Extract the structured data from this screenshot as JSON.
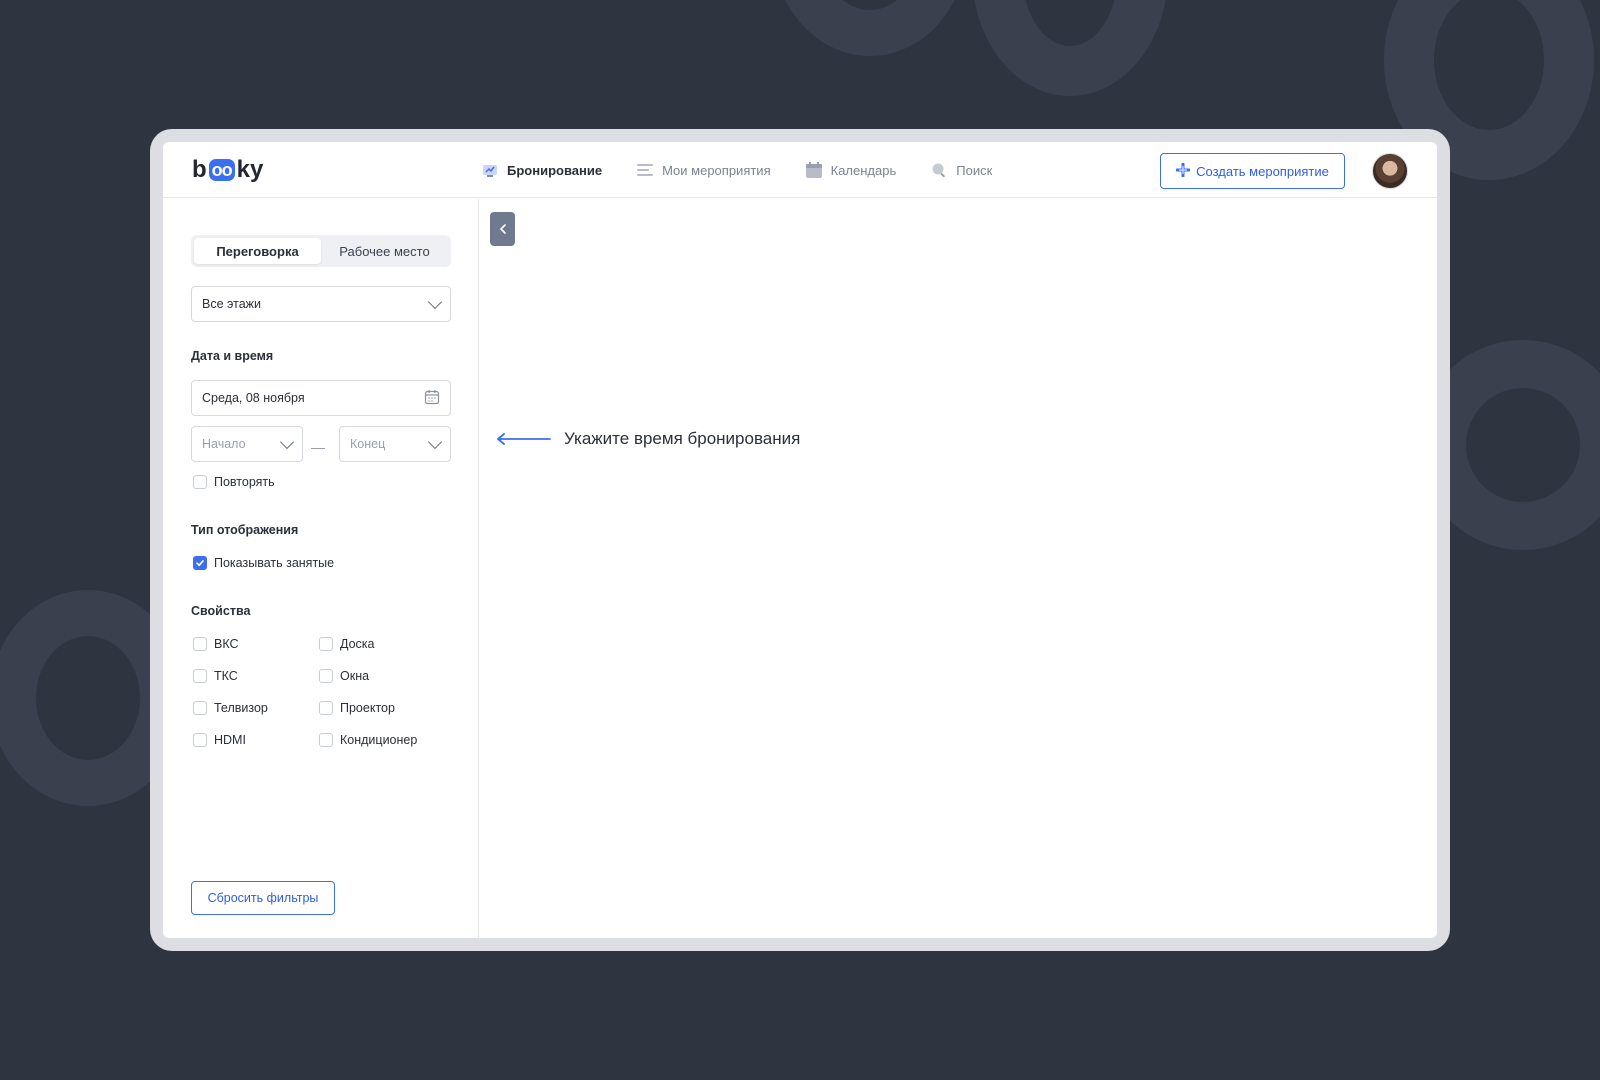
{
  "logo": {
    "prefix": "b",
    "oo": "oo",
    "suffix": "ky"
  },
  "nav": [
    {
      "label": "Бронирование",
      "icon": "booking-icon",
      "active": true
    },
    {
      "label": "Мои мероприятия",
      "icon": "list-icon",
      "active": false
    },
    {
      "label": "Календарь",
      "icon": "calendar-icon",
      "active": false
    },
    {
      "label": "Поиск",
      "icon": "search-icon",
      "active": false
    }
  ],
  "header": {
    "create_label": "Создать мероприятие"
  },
  "sidebar": {
    "tabs": [
      {
        "label": "Переговорка",
        "active": true
      },
      {
        "label": "Рабочее место",
        "active": false
      }
    ],
    "floor_select": "Все этажи",
    "datetime_title": "Дата и время",
    "date_value": "Среда, 08 ноября",
    "start_placeholder": "Начало",
    "end_placeholder": "Конец",
    "repeat_label": "Повторять",
    "repeat_checked": false,
    "display_title": "Тип отображения",
    "show_busy_label": "Показывать занятые",
    "show_busy_checked": true,
    "props_title": "Свойства",
    "properties": [
      {
        "label": "ВКС",
        "checked": false
      },
      {
        "label": "ТКС",
        "checked": false
      },
      {
        "label": "Телвизор",
        "checked": false
      },
      {
        "label": "HDMI",
        "checked": false
      },
      {
        "label": "Доска",
        "checked": false
      },
      {
        "label": "Окна",
        "checked": false
      },
      {
        "label": "Проектор",
        "checked": false
      },
      {
        "label": "Кондиционер",
        "checked": false
      }
    ],
    "reset_label": "Сбросить фильтры"
  },
  "main": {
    "hint": "Укажите время бронирования"
  },
  "colors": {
    "accent": "#3b6ff0",
    "background": "#2f3441",
    "collapse": "#6f7a8e"
  }
}
